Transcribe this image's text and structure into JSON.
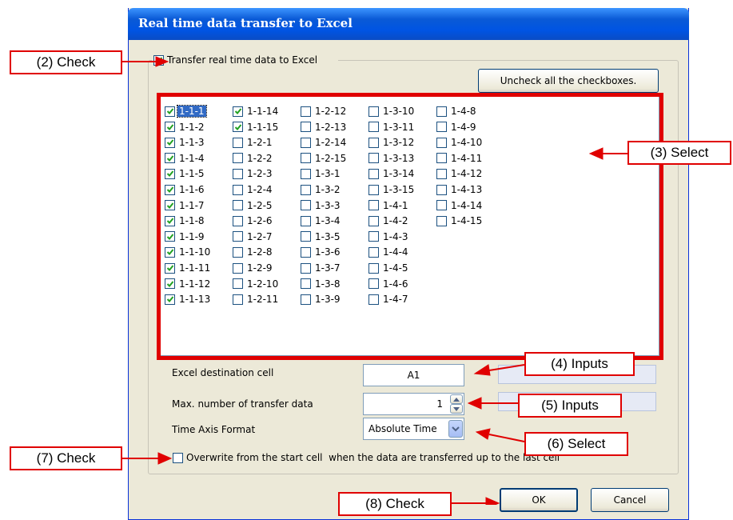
{
  "dialog": {
    "title": "Real time data transfer to Excel",
    "transfer_label": "Transfer real time data to Excel",
    "transfer_checked": true,
    "uncheck_all_label": "Uncheck all the checkboxes.",
    "channels": [
      {
        "label": "1-1-1",
        "checked": true
      },
      {
        "label": "1-1-2",
        "checked": true
      },
      {
        "label": "1-1-3",
        "checked": true
      },
      {
        "label": "1-1-4",
        "checked": true
      },
      {
        "label": "1-1-5",
        "checked": true
      },
      {
        "label": "1-1-6",
        "checked": true
      },
      {
        "label": "1-1-7",
        "checked": true
      },
      {
        "label": "1-1-8",
        "checked": true
      },
      {
        "label": "1-1-9",
        "checked": true
      },
      {
        "label": "1-1-10",
        "checked": true
      },
      {
        "label": "1-1-11",
        "checked": true
      },
      {
        "label": "1-1-12",
        "checked": true
      },
      {
        "label": "1-1-13",
        "checked": true
      },
      {
        "label": "1-1-14",
        "checked": true
      },
      {
        "label": "1-1-15",
        "checked": true
      },
      {
        "label": "1-2-1",
        "checked": false
      },
      {
        "label": "1-2-2",
        "checked": false
      },
      {
        "label": "1-2-3",
        "checked": false
      },
      {
        "label": "1-2-4",
        "checked": false
      },
      {
        "label": "1-2-5",
        "checked": false
      },
      {
        "label": "1-2-6",
        "checked": false
      },
      {
        "label": "1-2-7",
        "checked": false
      },
      {
        "label": "1-2-8",
        "checked": false
      },
      {
        "label": "1-2-9",
        "checked": false
      },
      {
        "label": "1-2-10",
        "checked": false
      },
      {
        "label": "1-2-11",
        "checked": false
      },
      {
        "label": "1-2-12",
        "checked": false
      },
      {
        "label": "1-2-13",
        "checked": false
      },
      {
        "label": "1-2-14",
        "checked": false
      },
      {
        "label": "1-2-15",
        "checked": false
      },
      {
        "label": "1-3-1",
        "checked": false
      },
      {
        "label": "1-3-2",
        "checked": false
      },
      {
        "label": "1-3-3",
        "checked": false
      },
      {
        "label": "1-3-4",
        "checked": false
      },
      {
        "label": "1-3-5",
        "checked": false
      },
      {
        "label": "1-3-6",
        "checked": false
      },
      {
        "label": "1-3-7",
        "checked": false
      },
      {
        "label": "1-3-8",
        "checked": false
      },
      {
        "label": "1-3-9",
        "checked": false
      },
      {
        "label": "1-3-10",
        "checked": false
      },
      {
        "label": "1-3-11",
        "checked": false
      },
      {
        "label": "1-3-12",
        "checked": false
      },
      {
        "label": "1-3-13",
        "checked": false
      },
      {
        "label": "1-3-14",
        "checked": false
      },
      {
        "label": "1-3-15",
        "checked": false
      },
      {
        "label": "1-4-1",
        "checked": false
      },
      {
        "label": "1-4-2",
        "checked": false
      },
      {
        "label": "1-4-3",
        "checked": false
      },
      {
        "label": "1-4-4",
        "checked": false
      },
      {
        "label": "1-4-5",
        "checked": false
      },
      {
        "label": "1-4-6",
        "checked": false
      },
      {
        "label": "1-4-7",
        "checked": false
      },
      {
        "label": "1-4-8",
        "checked": false
      },
      {
        "label": "1-4-9",
        "checked": false
      },
      {
        "label": "1-4-10",
        "checked": false
      },
      {
        "label": "1-4-11",
        "checked": false
      },
      {
        "label": "1-4-12",
        "checked": false
      },
      {
        "label": "1-4-13",
        "checked": false
      },
      {
        "label": "1-4-14",
        "checked": false
      },
      {
        "label": "1-4-15",
        "checked": false
      }
    ],
    "dest_cell_label": "Excel destination cell",
    "dest_cell_value": "A1",
    "max_transfer_label": "Max. number of transfer data",
    "max_transfer_value": "1",
    "time_axis_label": "Time Axis Format",
    "time_axis_value": "Absolute Time",
    "overwrite_label": "Overwrite from the start cell  when the data are transferred up to the last cell",
    "overwrite_checked": false,
    "ok_label": "OK",
    "cancel_label": "Cancel"
  },
  "annotations": {
    "check2": "(2) Check",
    "select3": "(3) Select",
    "inputs4": "(4) Inputs",
    "inputs5": "(5) Inputs",
    "select6": "(6) Select",
    "check7": "(7) Check",
    "check8": "(8) Check"
  },
  "colors": {
    "annotation_red": "#e00000",
    "titlebar_blue": "#0054e3",
    "dialog_bg": "#ece9d8"
  }
}
